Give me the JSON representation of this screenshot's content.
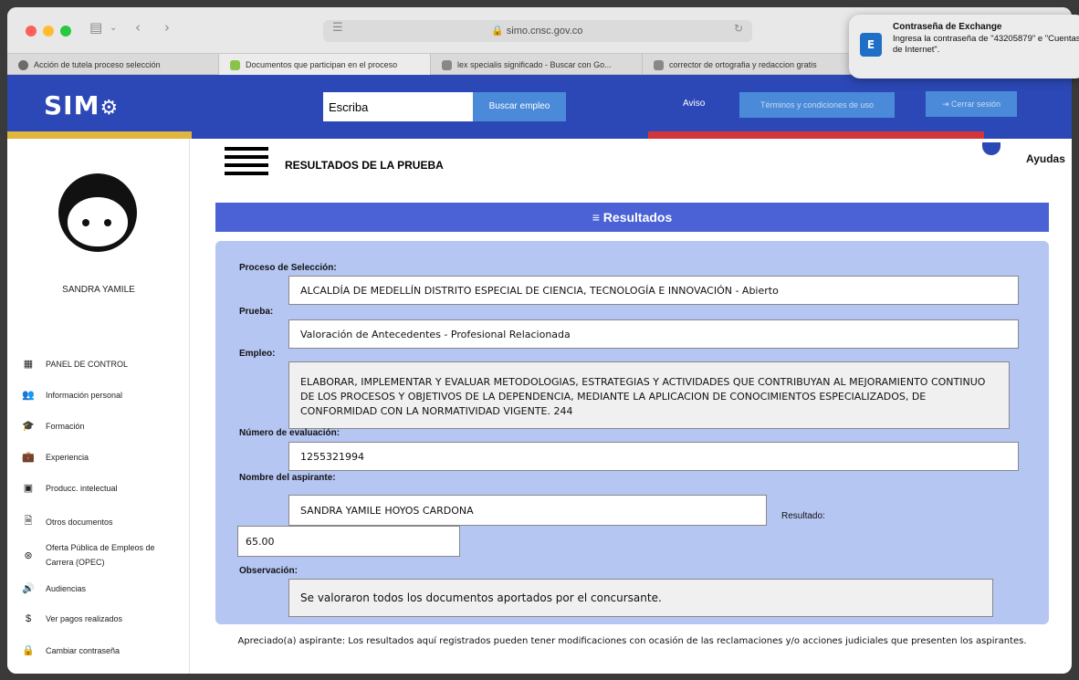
{
  "browser": {
    "url": "simo.cnsc.gov.co",
    "tabs": [
      {
        "label": "Acción de tutela proceso selección",
        "color": "#6b6b6b"
      },
      {
        "label": "Documentos que participan en el proceso",
        "color": "#8bc34a"
      },
      {
        "label": "lex specialis significado - Buscar con Go...",
        "color": "#888888"
      },
      {
        "label": "corrector de ortografia y redaccion gratis",
        "color": "#888888"
      }
    ]
  },
  "notification": {
    "title": "Contraseña de Exchange",
    "body": "Ingresa la contraseña de \"43205879\" e \"Cuentas de Internet\"."
  },
  "header": {
    "logo": "SIM",
    "search_value": "Escriba",
    "search_button": "Buscar empleo",
    "aviso": "Aviso",
    "terminos": "Términos y condiciones de uso",
    "cerrar": "Cerrar sesión"
  },
  "sidebar": {
    "user_name": "SANDRA YAMILE",
    "items": [
      {
        "label": "PANEL DE CONTROL"
      },
      {
        "label": "Información personal"
      },
      {
        "label": "Formación"
      },
      {
        "label": "Experiencia"
      },
      {
        "label": "Producc. intelectual"
      },
      {
        "label": "Otros documentos"
      },
      {
        "label": "Oferta Pública de Empleos de Carrera (OPEC)"
      },
      {
        "label": "Audiencias"
      },
      {
        "label": "Ver pagos realizados"
      },
      {
        "label": "Cambiar contraseña"
      }
    ]
  },
  "main": {
    "page_title": "RESULTADOS DE LA PRUEBA",
    "ayudas": "Ayudas",
    "results_header": "≡ Resultados",
    "fields": {
      "proceso_label": "Proceso de Selección:",
      "proceso_value": "ALCALDÍA DE MEDELLÍN DISTRITO ESPECIAL DE CIENCIA, TECNOLOGÍA E INNOVACIÓN - Abierto",
      "prueba_label": "Prueba:",
      "prueba_value": "Valoración de Antecedentes - Profesional Relacionada",
      "empleo_label": "Empleo:",
      "empleo_value": "ELABORAR, IMPLEMENTAR Y EVALUAR METODOLOGIAS, ESTRATEGIAS Y ACTIVIDADES QUE CONTRIBUYAN AL MEJORAMIENTO CONTINUO DE LOS PROCESOS Y OBJETIVOS DE LA DEPENDENCIA, MEDIANTE LA APLICACION DE CONOCIMIENTOS ESPECIALIZADOS, DE CONFORMIDAD CON LA NORMATIVIDAD VIGENTE. 244",
      "numero_label": "Número de evaluación:",
      "numero_value": "1255321994",
      "nombre_label": "Nombre del aspirante:",
      "nombre_value": "SANDRA YAMILE HOYOS CARDONA",
      "resultado_label": "Resultado:",
      "resultado_value": "65.00",
      "observacion_label": "Observación:",
      "observacion_value": "Se valoraron todos los documentos aportados por el concursante."
    },
    "footer_note": "Apreciado(a) aspirante: Los resultados aquí registrados pueden tener modificaciones con ocasión de las reclamaciones y/o acciones judiciales que presenten los aspirantes."
  },
  "colors": {
    "header_blue": "#2c48b6",
    "accent_blue": "#4a8ad9",
    "panel_blue": "#b5c6f3",
    "stripe_yellow": "#e0b63f",
    "stripe_blue": "#2c48b6",
    "stripe_red": "#d2363a"
  }
}
